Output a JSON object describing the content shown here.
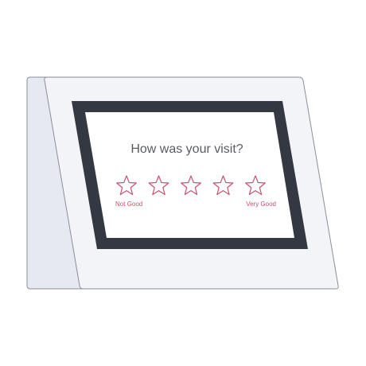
{
  "screen": {
    "question": "How was your visit?",
    "rating": {
      "max": 5,
      "value": 0,
      "low_label": "Not Good",
      "high_label": "Very Good",
      "icon": "star-outline-icon"
    }
  },
  "colors": {
    "accent": "#c9506e",
    "bezel": "#343843",
    "device_body": "#f3f4f8",
    "device_side": "#e6e9f1",
    "text": "#5a5c66"
  }
}
